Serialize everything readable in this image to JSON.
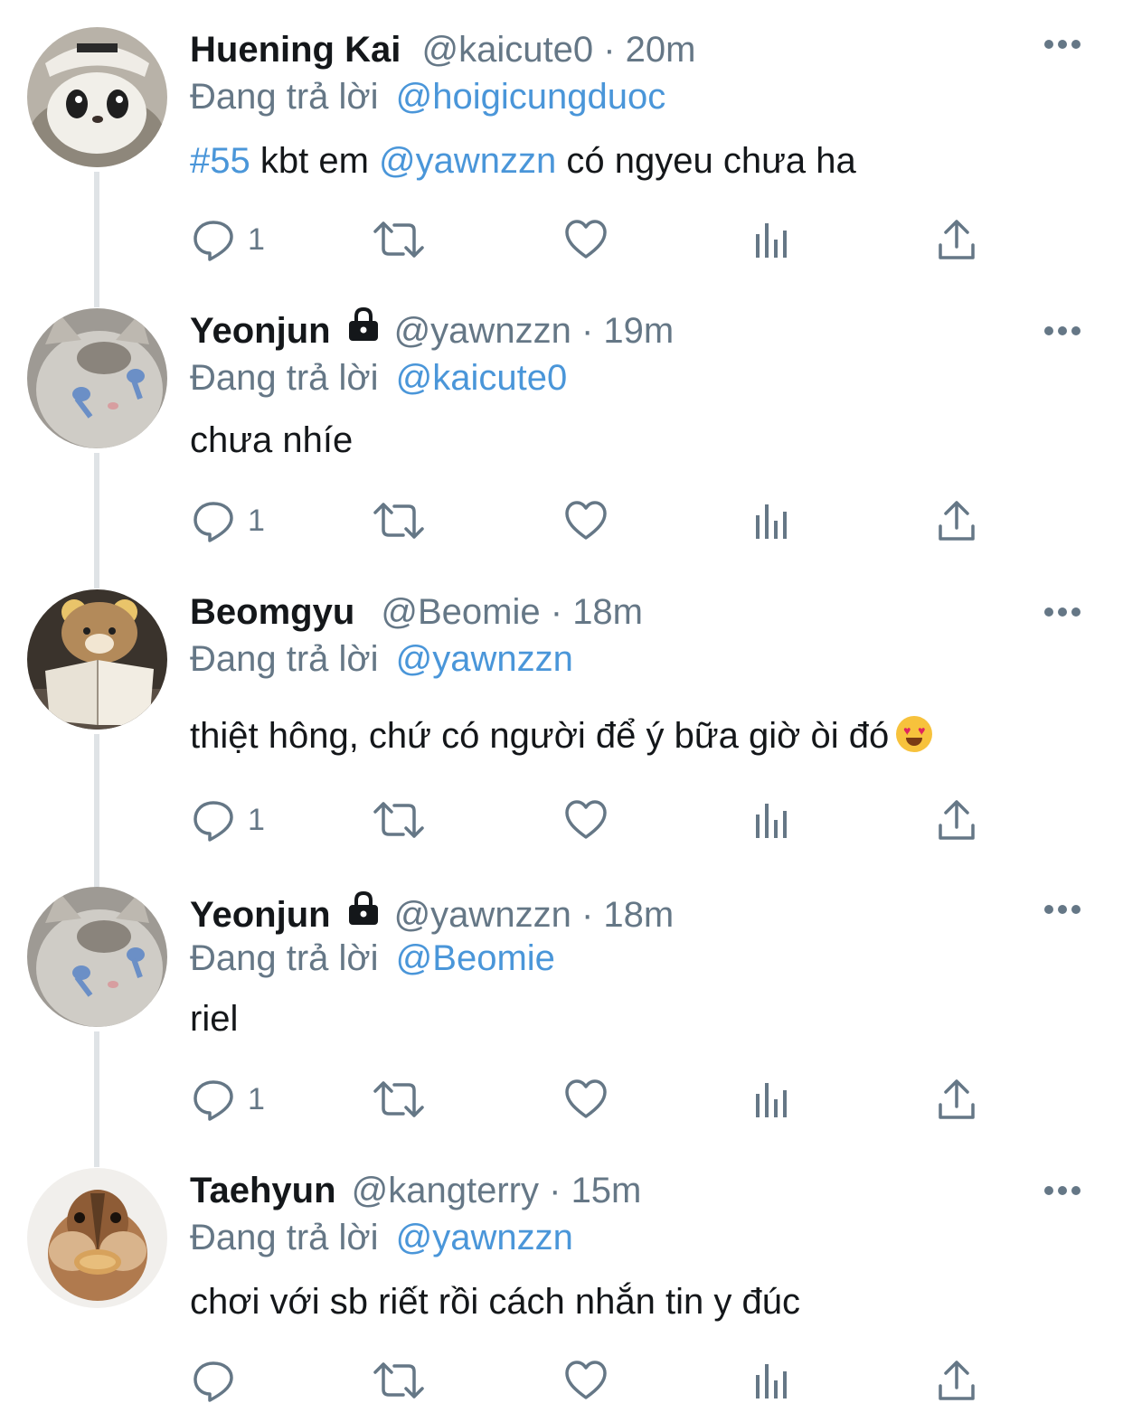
{
  "tweets": [
    {
      "name": "Huening Kai",
      "handle": "@kaicute0",
      "dot": "·",
      "time": "20m",
      "locked": false,
      "reply_prefix": "Đang trả lời",
      "reply_to": "@hoigicungduoc",
      "text_parts": [
        "#55",
        " kbt em ",
        "@yawnzzn",
        " có ngyeu chưa ha"
      ],
      "reply_count": "1",
      "avatar": "penguin-plush-avatar"
    },
    {
      "name": "Yeonjun",
      "handle": "@yawnzzn",
      "dot": "·",
      "time": "19m",
      "locked": true,
      "reply_prefix": "Đang trả lời",
      "reply_to": "@kaicute0",
      "text": "chưa nhíe",
      "reply_count": "1",
      "avatar": "crying-kitten-avatar"
    },
    {
      "name": "Beomgyu",
      "handle": "@Beomie",
      "dot": "·",
      "time": "18m",
      "locked": false,
      "reply_prefix": "Đang trả lời",
      "reply_to": "@yawnzzn",
      "text": "thiệt hông, chứ có người để ý bữa giờ òi đó",
      "emoji": "heart-eyes-emoji",
      "reply_count": "1",
      "avatar": "bear-plush-book-avatar"
    },
    {
      "name": "Yeonjun",
      "handle": "@yawnzzn",
      "dot": "·",
      "time": "18m",
      "locked": true,
      "reply_prefix": "Đang trả lời",
      "reply_to": "@Beomie",
      "text": "riel",
      "reply_count": "1",
      "avatar": "crying-kitten-avatar"
    },
    {
      "name": "Taehyun",
      "handle": "@kangterry",
      "dot": "·",
      "time": "15m",
      "locked": false,
      "reply_prefix": "Đang trả lời",
      "reply_to": "@yawnzzn",
      "text": "chơi với sb riết rồi cách nhắn tin y đúc",
      "reply_count": "",
      "avatar": "chipmunk-avatar"
    }
  ],
  "colors": {
    "text": "#14171a",
    "secondary": "#657786",
    "link": "#4a96d9",
    "thread_line": "#dfe3e6"
  }
}
